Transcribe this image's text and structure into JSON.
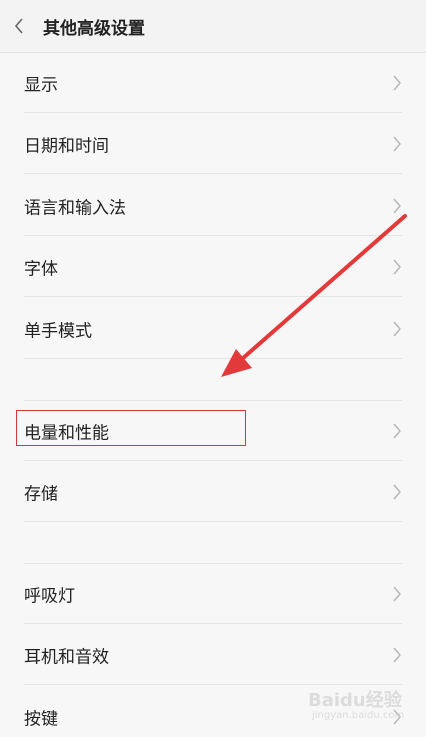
{
  "header": {
    "title": "其他高级设置",
    "back_icon": "chevron-left-icon"
  },
  "items": [
    {
      "label": "显示"
    },
    {
      "label": "日期和时间"
    },
    {
      "label": "语言和输入法"
    },
    {
      "label": "字体"
    },
    {
      "label": "单手模式"
    },
    {
      "label": "电量和性能"
    },
    {
      "label": "存储"
    },
    {
      "label": "呼吸灯"
    },
    {
      "label": "耳机和音效"
    },
    {
      "label": "按键"
    }
  ],
  "annotation": {
    "highlight_color": "#d23a3a",
    "arrow_color": "#e23a3a"
  },
  "watermark": {
    "text": "Baidu经验",
    "sub": "jingyan.baidu.com"
  },
  "colors": {
    "background": "#f7f7f7",
    "header_bg": "#f3f3f3",
    "divider": "#e4e4e4",
    "chevron": "#b5b5b5"
  }
}
